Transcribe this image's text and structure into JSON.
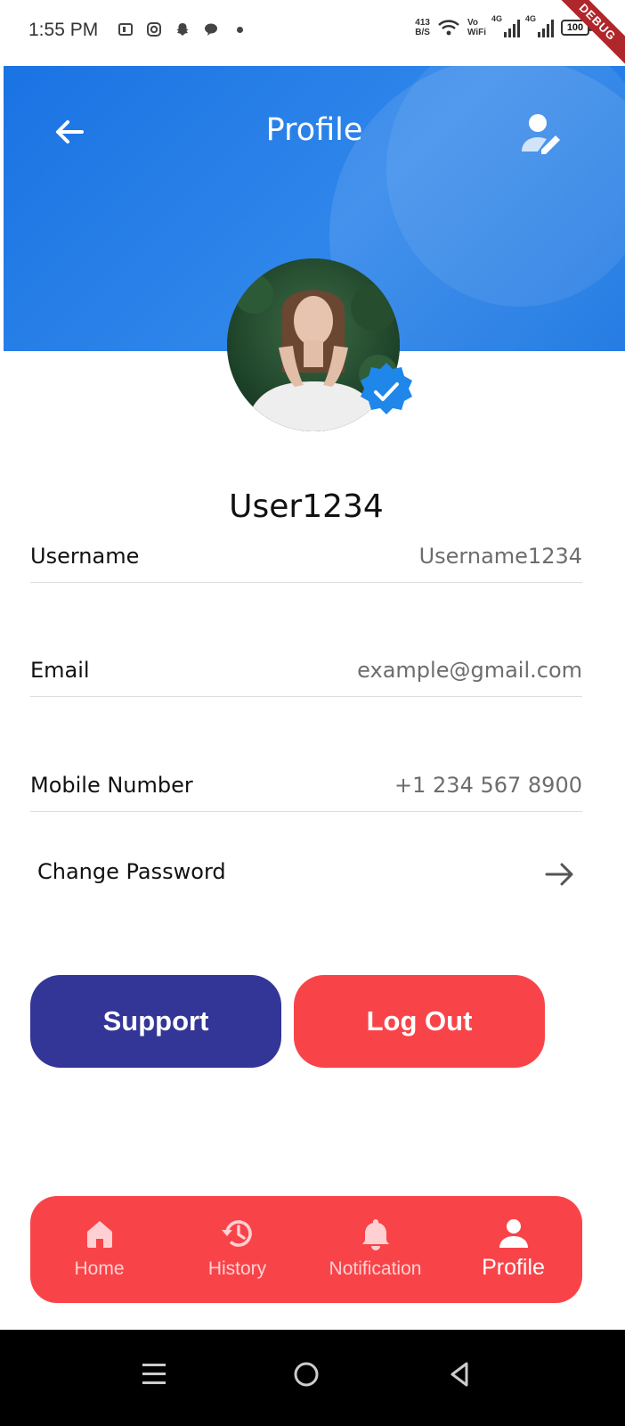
{
  "status_bar": {
    "time": "1:55 PM",
    "net_speed_value": "413",
    "net_speed_unit": "B/S",
    "vowifi_top": "Vo",
    "vowifi_bottom": "WiFi",
    "signal_1_label": "4G",
    "signal_2_label": "4G",
    "battery": "100",
    "debug_banner": "DEBUG"
  },
  "header": {
    "title": "Profile",
    "back_icon": "arrow-left-icon",
    "edit_icon": "user-edit-icon",
    "color": "#1a7ae6"
  },
  "profile": {
    "display_name": "User1234",
    "verified_icon": "verified-badge-icon",
    "fields": [
      {
        "label": "Username",
        "value": "Username1234"
      },
      {
        "label": "Email",
        "value": "example@gmail.com"
      },
      {
        "label": "Mobile Number",
        "value": "+1 234 567 8900"
      }
    ],
    "change_password": "Change Password"
  },
  "actions": {
    "support": "Support",
    "logout": "Log Out",
    "support_color": "#333597",
    "logout_color": "#f84449"
  },
  "bottom_nav": {
    "items": [
      {
        "label": "Home",
        "icon": "home-icon"
      },
      {
        "label": "History",
        "icon": "history-icon"
      },
      {
        "label": "Notification",
        "icon": "bell-icon"
      },
      {
        "label": "Profile",
        "icon": "person-icon"
      }
    ],
    "active": "Profile"
  },
  "system_nav": {
    "icons": [
      "menu-icon",
      "home-circle-icon",
      "back-triangle-icon"
    ]
  }
}
